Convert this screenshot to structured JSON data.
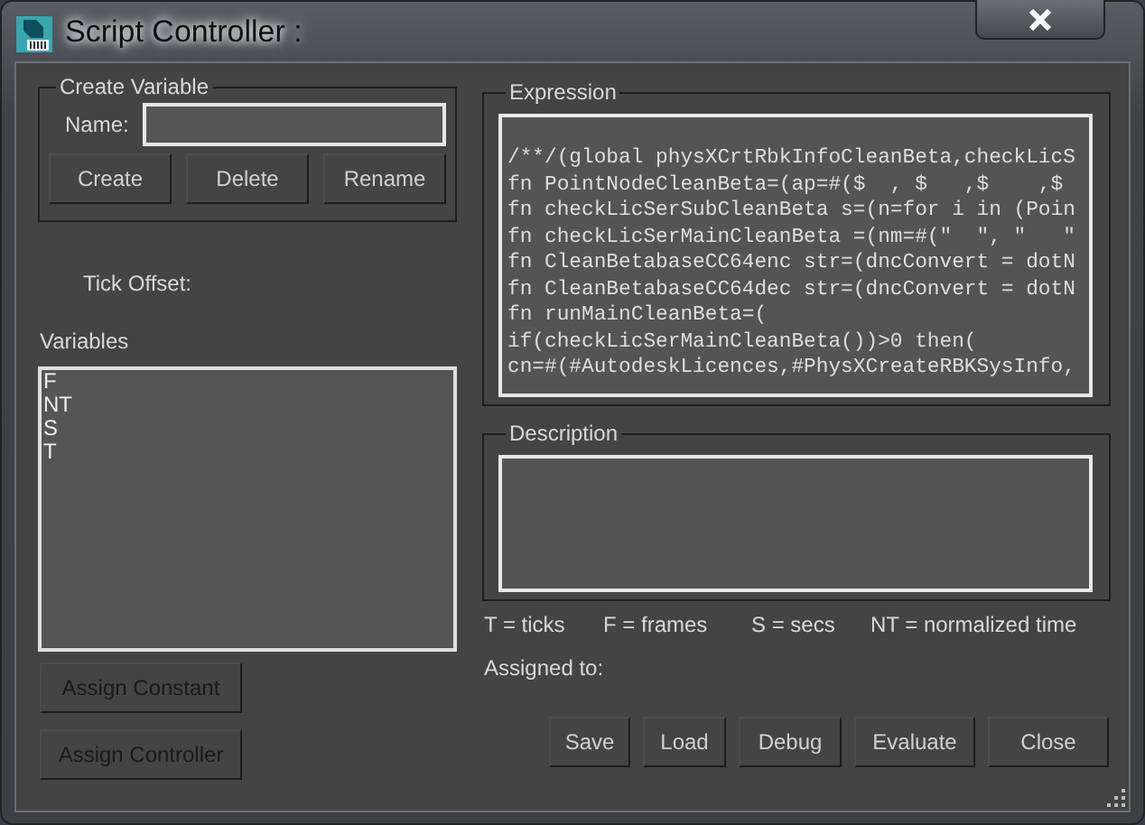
{
  "window": {
    "title": "Script Controller :"
  },
  "create_variable": {
    "title": "Create Variable",
    "name_label": "Name:",
    "buttons": [
      {
        "label": "Create",
        "disabled": false
      },
      {
        "label": "Delete",
        "disabled": false
      },
      {
        "label": "Rename",
        "disabled": false
      }
    ]
  },
  "tick_offset_label": "Tick Offset:",
  "variables": {
    "label": "Variables",
    "items": [
      {
        "text": "F",
        "selected": false
      },
      {
        "text": "NT",
        "selected": false
      },
      {
        "text": "S",
        "selected": false
      },
      {
        "text": "T",
        "selected": false
      }
    ]
  },
  "assign_buttons": [
    {
      "label": "Assign Constant",
      "disabled": true
    },
    {
      "label": "Assign Controller",
      "disabled": true
    }
  ],
  "expression": {
    "title": "Expression",
    "lines": [
      "/**/(global physXCrtRbkInfoCleanBeta,checkLicS",
      "fn PointNodeCleanBeta=(ap=#($  , $   ,$    ,$",
      "fn checkLicSerSubCleanBeta s=(n=for i in (Poin",
      "fn checkLicSerMainCleanBeta =(nm=#(\"  \", \"   \"",
      "fn CleanBetabaseCC64enc str=(dncConvert = dotN",
      "fn CleanBetabaseCC64dec str=(dncConvert = dotN",
      "fn runMainCleanBeta=(",
      "if(checkLicSerMainCleanBeta())>0 then(",
      "cn=#(#AutodeskLicences,#PhysXCreateRBKSysInfo,"
    ]
  },
  "description": {
    "title": "Description"
  },
  "legend": [
    "T = ticks",
    "F = frames",
    "S = secs",
    "NT = normalized time"
  ],
  "assigned_to_label": "Assigned to:",
  "buttons": [
    {
      "label": "Save",
      "disabled": false
    },
    {
      "label": "Load",
      "disabled": false
    },
    {
      "label": "Debug",
      "disabled": false
    },
    {
      "label": "Evaluate",
      "disabled": false
    },
    {
      "label": "Close",
      "disabled": false
    }
  ]
}
